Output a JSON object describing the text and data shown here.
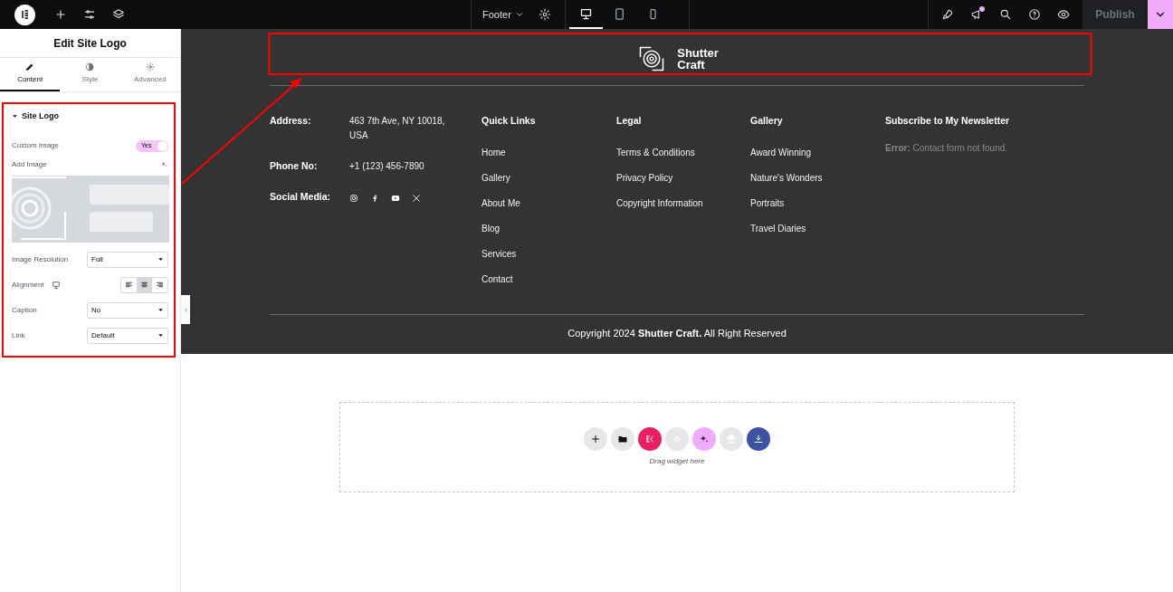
{
  "top_bar": {
    "left_tools": [
      {
        "kind": "logo"
      },
      {
        "kind": "add"
      },
      {
        "kind": "settings"
      },
      {
        "kind": "layers"
      }
    ],
    "document": {
      "label": "Footer"
    },
    "devices": [
      {
        "kind": "desktop",
        "selected": true
      },
      {
        "kind": "tablet",
        "selected": false
      },
      {
        "kind": "mobile",
        "selected": false
      }
    ],
    "right_tools": [
      {
        "kind": "rocket",
        "notification": false
      },
      {
        "kind": "megaphone",
        "notification": true
      },
      {
        "kind": "search",
        "notification": false
      },
      {
        "kind": "help",
        "notification": false
      },
      {
        "kind": "preview",
        "notification": false
      }
    ],
    "publish": {
      "label": "Publish",
      "disabled": true
    }
  },
  "panel": {
    "title": "Edit Site Logo",
    "tabs": [
      {
        "label": "Content",
        "selected": true
      },
      {
        "label": "Style",
        "selected": false
      },
      {
        "label": "Advanced",
        "selected": false
      }
    ],
    "section": {
      "title": "Site Logo",
      "expanded": true,
      "custom_image": {
        "label": "Custom Image",
        "value": "Yes",
        "on": true
      },
      "add_image": {
        "label": "Add Image"
      },
      "fields": [
        {
          "kind": "select",
          "label": "Image Resolution",
          "value": "Full"
        },
        {
          "kind": "align",
          "label": "Alignment",
          "options": [
            {
              "kind": "left",
              "selected": false
            },
            {
              "kind": "center",
              "selected": true
            },
            {
              "kind": "right",
              "selected": false
            }
          ]
        },
        {
          "kind": "select",
          "label": "Caption",
          "value": "No"
        },
        {
          "kind": "select",
          "label": "Link",
          "value": "Default"
        }
      ]
    }
  },
  "footer": {
    "logo_lines": [
      "Shutter",
      "Craft"
    ],
    "contact": [
      {
        "label": "Address:",
        "value": "463 7th Ave, NY 10018, USA"
      },
      {
        "label": "Phone No:",
        "value": "+1 (123) 456-7890"
      },
      {
        "label": "Social Media:",
        "socials": [
          {
            "kind": "instagram"
          },
          {
            "kind": "facebook"
          },
          {
            "kind": "youtube"
          },
          {
            "kind": "x"
          }
        ]
      }
    ],
    "columns": [
      {
        "title": "Quick Links",
        "links": [
          "Home",
          "Gallery",
          "About Me",
          "Blog",
          "Services",
          "Contact"
        ]
      },
      {
        "title": "Legal",
        "links": [
          "Terms & Conditions",
          "Privacy Policy",
          "Copyright Information"
        ]
      },
      {
        "title": "Gallery",
        "links": [
          "Award Winning",
          "Nature's Wonders",
          "Portraits",
          "Travel Diaries"
        ]
      }
    ],
    "newsletter": {
      "title": "Subscribe to My Newsletter",
      "message": "**Error:** Contact form not found."
    },
    "copyright": "Copyright 2024 **Shutter Craft.** All Right Reserved"
  },
  "drop_zone": {
    "buttons": [
      {
        "kind": "add",
        "color": "#e6e7e8"
      },
      {
        "kind": "folder",
        "color": "#e6e7e8"
      },
      {
        "kind": "kit",
        "color": "#e91e63"
      },
      {
        "kind": "ring",
        "color": "#e6e7e8"
      },
      {
        "kind": "sparkle",
        "color": "#f0abfc"
      },
      {
        "kind": "cloud",
        "color": "#e6e7e8"
      },
      {
        "kind": "download",
        "color": "#3f51a3"
      }
    ],
    "hint": "Drag widget here"
  }
}
